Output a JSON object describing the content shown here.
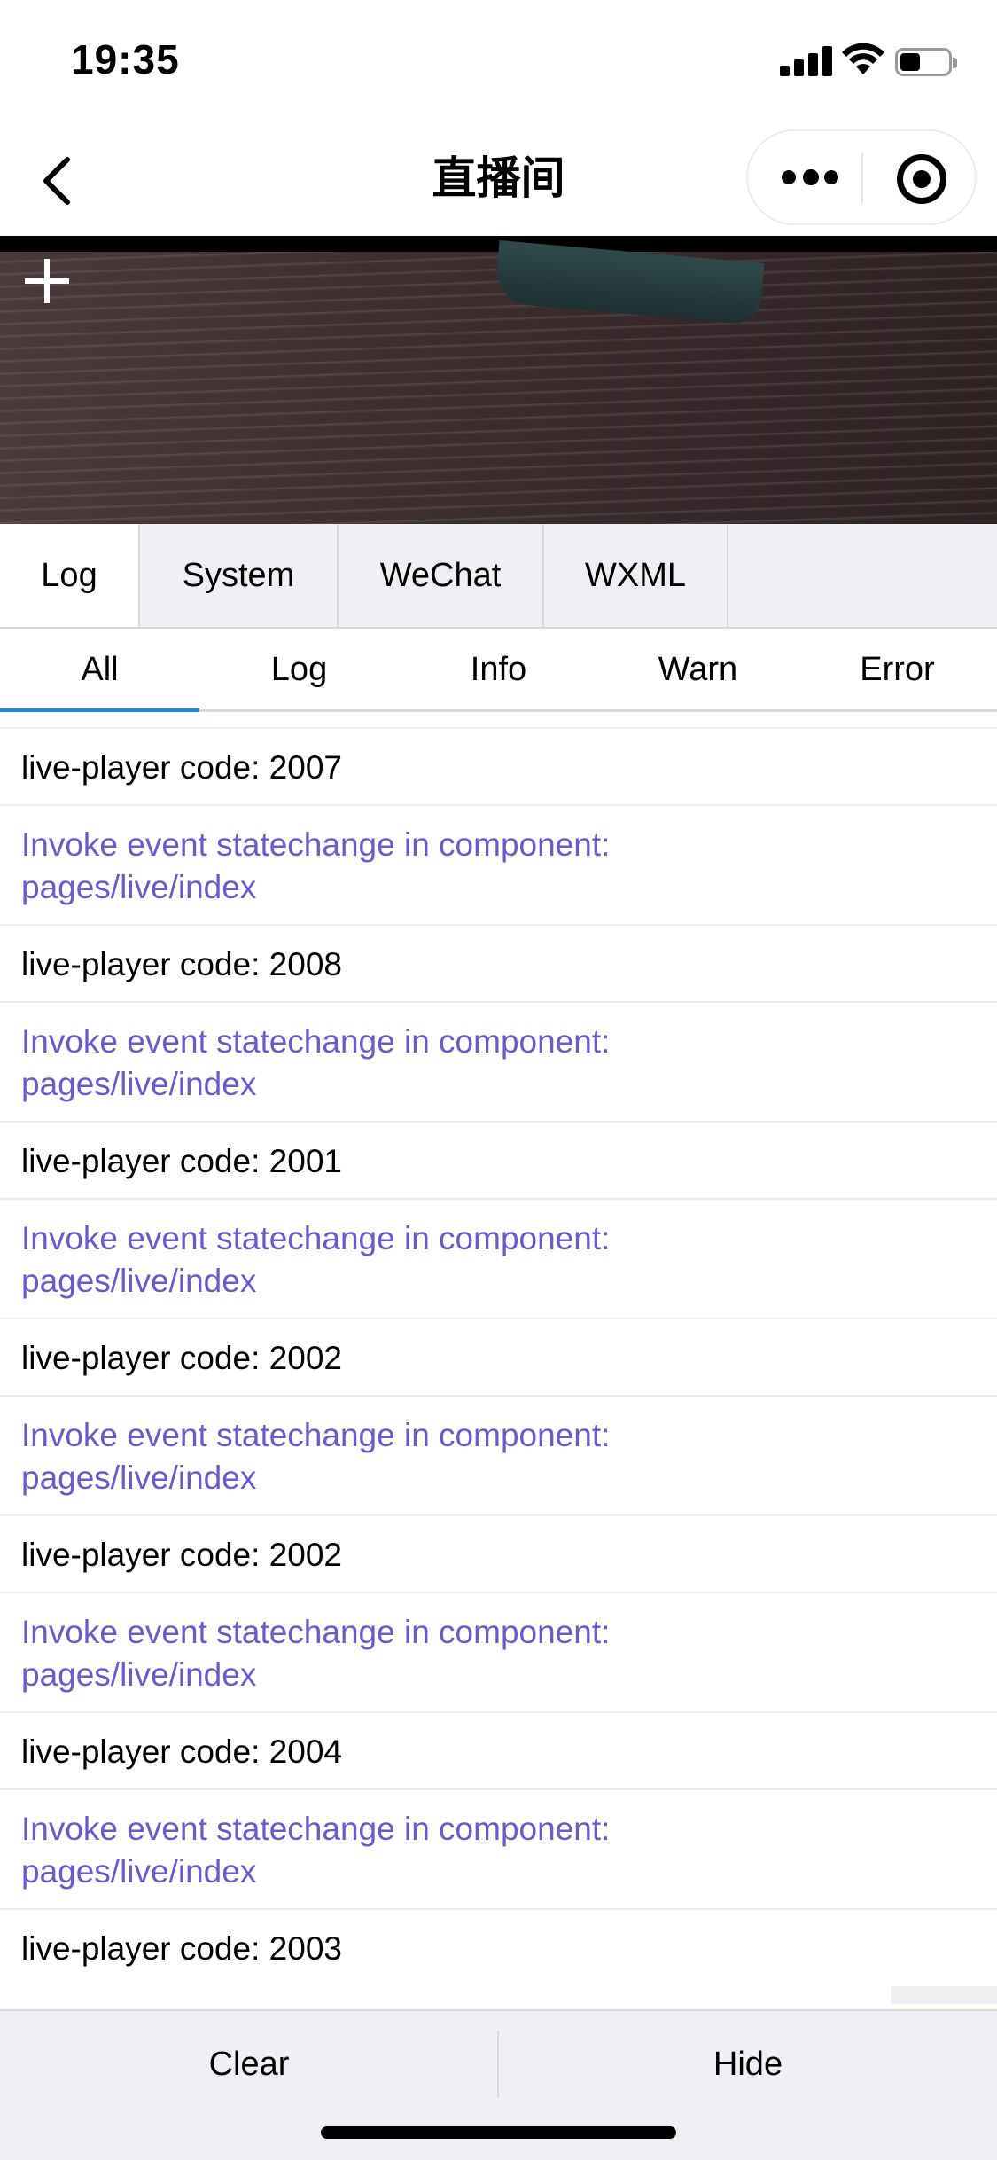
{
  "status_bar": {
    "time": "19:35"
  },
  "nav": {
    "title": "直播间"
  },
  "vconsole": {
    "tabs": [
      {
        "label": "Log"
      },
      {
        "label": "System"
      },
      {
        "label": "WeChat"
      },
      {
        "label": "WXML"
      }
    ],
    "subtabs": [
      {
        "label": "All"
      },
      {
        "label": "Log"
      },
      {
        "label": "Info"
      },
      {
        "label": "Warn"
      },
      {
        "label": "Error"
      }
    ],
    "logs": [
      {
        "text": "live-player code: 2007"
      },
      {
        "line1": "Invoke event statechange in component:",
        "line2": "pages/live/index"
      },
      {
        "text": "live-player code: 2008"
      },
      {
        "line1": "Invoke event statechange in component:",
        "line2": "pages/live/index"
      },
      {
        "text": "live-player code: 2001"
      },
      {
        "line1": "Invoke event statechange in component:",
        "line2": "pages/live/index"
      },
      {
        "text": "live-player code: 2002"
      },
      {
        "line1": "Invoke event statechange in component:",
        "line2": "pages/live/index"
      },
      {
        "text": "live-player code: 2002"
      },
      {
        "line1": "Invoke event statechange in component:",
        "line2": "pages/live/index"
      },
      {
        "text": "live-player code: 2004"
      },
      {
        "line1": "Invoke event statechange in component:",
        "line2": "pages/live/index"
      },
      {
        "text": "live-player code: 2003"
      }
    ],
    "toolbar": {
      "clear_label": "Clear",
      "hide_label": "Hide"
    }
  },
  "colors": {
    "info_text": "#6a5acd",
    "active_tab_indicator": "#1485ee",
    "panel_background": "#efeff4"
  }
}
